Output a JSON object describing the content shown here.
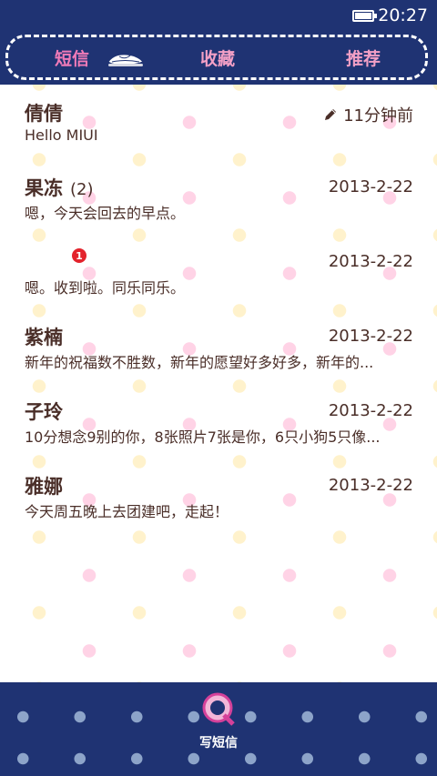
{
  "status_bar": {
    "time": "20:27"
  },
  "tabs": [
    {
      "label": "短信"
    },
    {
      "label": "收藏"
    },
    {
      "label": "推荐"
    }
  ],
  "messages": [
    {
      "name": "倩倩",
      "count": "",
      "time": "11分钟前",
      "snippet": "Hello MIUI",
      "draft": true
    },
    {
      "name": "果冻",
      "count": "(2)",
      "time": "2013-2-22",
      "snippet": "嗯，今天会回去的早点。"
    },
    {
      "name": "",
      "count": "",
      "time": "2013-2-22",
      "snippet": "嗯。收到啦。同乐同乐。",
      "badge": "1"
    },
    {
      "name": "紫楠",
      "count": "",
      "time": "2013-2-22",
      "snippet": "新年的祝福数不胜数，新年的愿望好多好多，新年的..."
    },
    {
      "name": "子玲",
      "count": "",
      "time": "2013-2-22",
      "snippet": "10分想念9别的你，8张照片7张是你，6只小狗5只像..."
    },
    {
      "name": "雅娜",
      "count": "",
      "time": "2013-2-22",
      "snippet": "今天周五晚上去团建吧，走起！"
    }
  ],
  "compose": {
    "label": "写短信"
  },
  "colors": {
    "bar": "#1f3373",
    "tab_active": "#f17bb8",
    "tab_inactive": "#f3a0c6",
    "text": "#4a2e28",
    "dot_pink": "#ffd3e6",
    "dot_yellow": "#fff2cc",
    "badge": "#e3232c"
  }
}
